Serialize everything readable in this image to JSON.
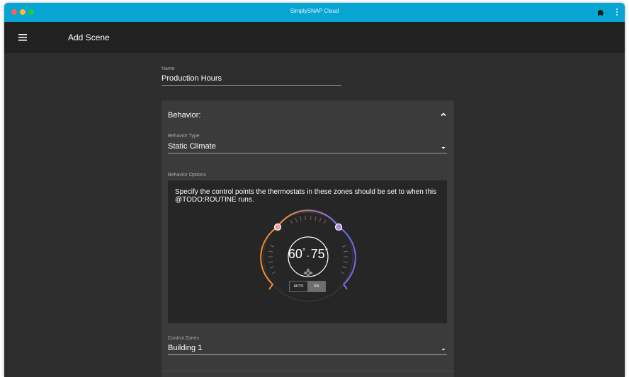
{
  "window": {
    "title": "SimplySNAP Cloud",
    "accent_color": "#07a5d1"
  },
  "appbar": {
    "menu_icon": "hamburger-menu-icon",
    "title": "Add Scene"
  },
  "form": {
    "name_label": "Name",
    "name_value": "Production Hours"
  },
  "behavior": {
    "heading": "Behavior:",
    "type_label": "Behavior Type",
    "type_value": "Static Climate",
    "options_label": "Behavior Options",
    "options_text": "Specify the control points the thermostats in these zones should be set to when this @TODO:ROUTINE runs.",
    "control_zones_label": "Control Zones",
    "control_zones_value": "Building 1"
  },
  "thermostat": {
    "heat_setpoint": "60",
    "cool_setpoint": "75",
    "degree_symbol": "°",
    "separator": "-",
    "heat_color": "#f28a30",
    "cool_color": "#7b68ee",
    "fan_icon": "fan-icon",
    "mode_auto": "AUTO",
    "mode_on": "ON",
    "mode_selected": "ON"
  }
}
